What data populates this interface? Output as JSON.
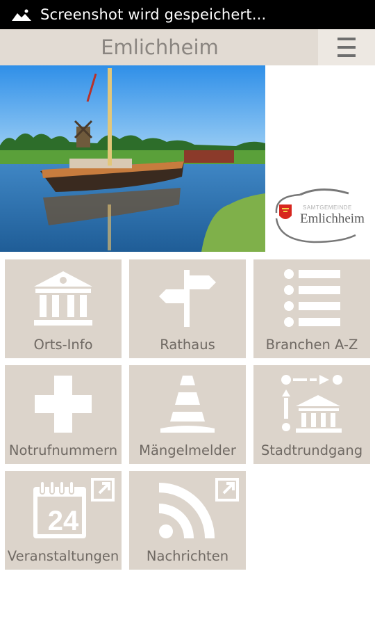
{
  "status_bar": {
    "text": "Screenshot wird gespeichert..."
  },
  "header": {
    "title": "Emlichheim"
  },
  "logo": {
    "small_text": "SAMTGEMEINDE",
    "name": "Emlichheim"
  },
  "tiles": [
    {
      "label": "Orts-Info",
      "icon": "museum-icon"
    },
    {
      "label": "Rathaus",
      "icon": "signpost-icon"
    },
    {
      "label": "Branchen A-Z",
      "icon": "list-icon"
    },
    {
      "label": "Notrufnummern",
      "icon": "cross-icon"
    },
    {
      "label": "Mängelmelder",
      "icon": "traffic-cone-icon"
    },
    {
      "label": "Stadtrundgang",
      "icon": "tour-route-icon"
    },
    {
      "label": "Veranstaltungen",
      "icon": "calendar-icon",
      "external": true,
      "calendar_day": "24"
    },
    {
      "label": "Nachrichten",
      "icon": "rss-icon",
      "external": true
    }
  ]
}
